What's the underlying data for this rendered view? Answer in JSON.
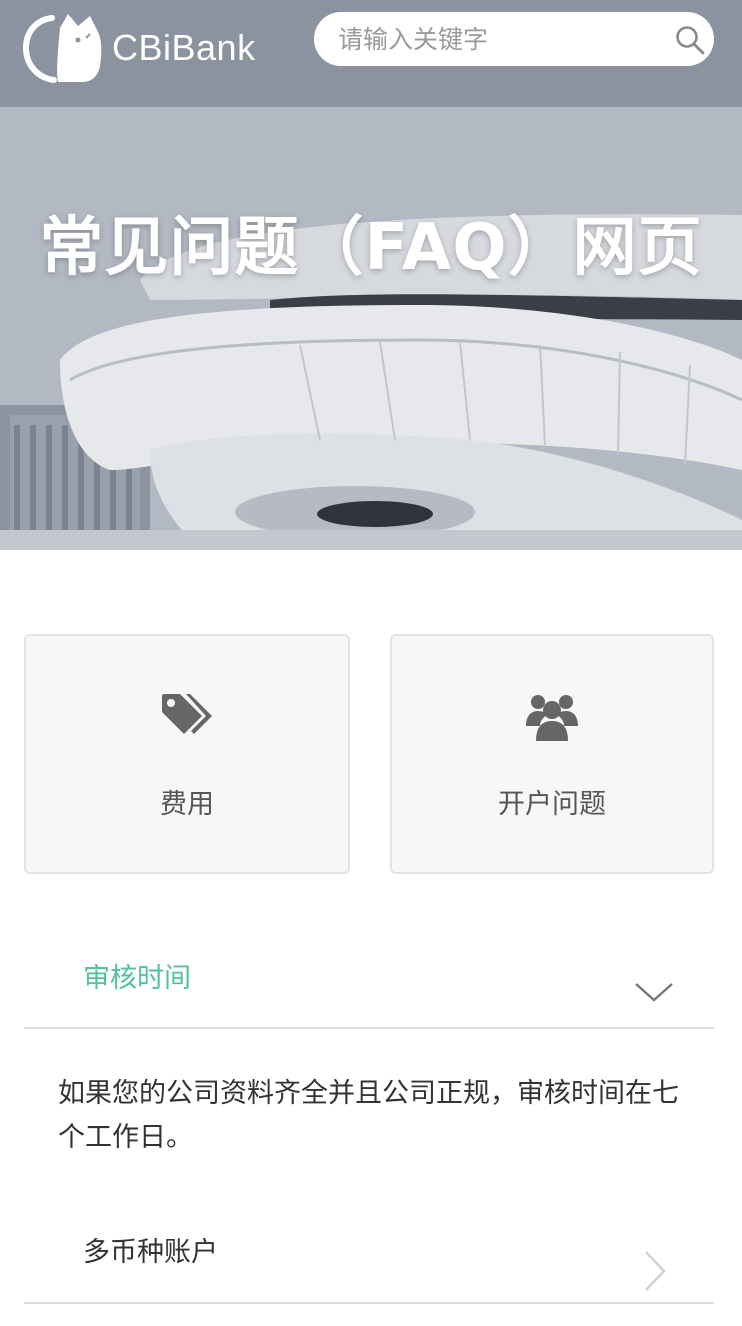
{
  "header": {
    "brand": "CBiBank",
    "search_placeholder": "请输入关键字",
    "search_value": ""
  },
  "hero": {
    "title": "常见问题（FAQ）网页"
  },
  "categories": [
    {
      "label": "费用",
      "icon": "tags-icon"
    },
    {
      "label": "开户问题",
      "icon": "users-icon"
    }
  ],
  "faq": {
    "expanded": {
      "question": "审核时间",
      "answer": "如果您的公司资料齐全并且公司正规，审核时间在七个工作日。"
    },
    "collapsed": [
      {
        "question": "多币种账户"
      }
    ]
  },
  "colors": {
    "accent": "#4fc2a1",
    "icon": "#666666",
    "card_bg": "#f7f7f7",
    "divider": "#dcdcdc"
  }
}
